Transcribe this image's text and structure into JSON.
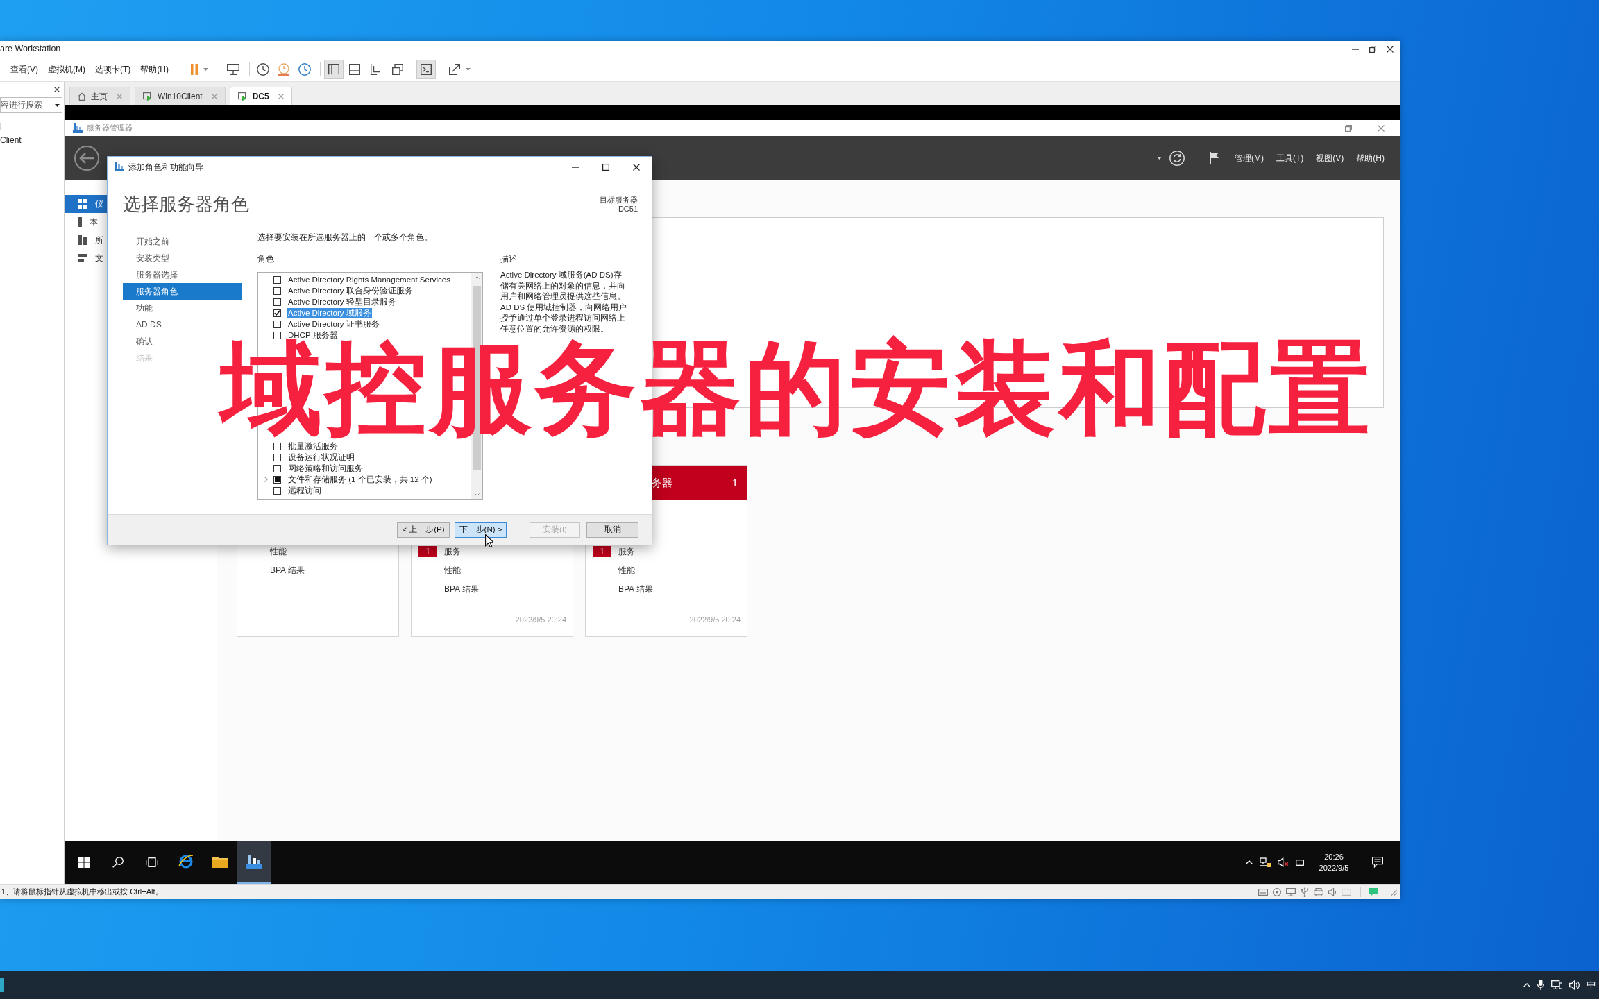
{
  "vmware": {
    "title": "are Workstation",
    "menu": [
      "查看(V)",
      "虚拟机(M)",
      "选项卡(T)",
      "帮助(H)"
    ],
    "toolbar": [
      {
        "pressed": false
      },
      {
        "pressed": false
      },
      {
        "pressed": false
      },
      {
        "pressed": false
      },
      {
        "pressed": false
      },
      {
        "pressed": true
      },
      {
        "pressed": false
      },
      {
        "pressed": false
      },
      {
        "pressed": false
      },
      {
        "pressed": true
      },
      {
        "pressed": false
      }
    ],
    "library": {
      "search": {
        "placeholder": "容进行搜索"
      },
      "items": [
        "l",
        "Client"
      ]
    },
    "tabs": [
      {
        "label": "主页",
        "kind": "home",
        "selected": false
      },
      {
        "label": "Win10Client",
        "kind": "vm",
        "selected": false
      },
      {
        "label": "DC5",
        "kind": "vm",
        "selected": true
      }
    ],
    "status_bar": "1、请将鼠标指针从虚拟机中移出或按 Ctrl+Alt。"
  },
  "server_manager": {
    "title": "服务器管理器",
    "menu": [
      "管理(M)",
      "工具(T)",
      "视图(V)",
      "帮助(H)"
    ],
    "nav": [
      {
        "label": "仪",
        "selected": true
      },
      {
        "label": "本",
        "selected": false
      },
      {
        "label": "所",
        "selected": false
      },
      {
        "label": "文",
        "selected": false
      }
    ],
    "tiles": [
      {
        "rows": [
          {
            "label": "性能"
          },
          {
            "label": "BPA 结果"
          }
        ]
      },
      {
        "rows": [
          {
            "label": "服务",
            "badge": "1"
          },
          {
            "label": "性能"
          },
          {
            "label": "BPA 结果"
          }
        ],
        "timestamp": "2022/9/5 20:24"
      },
      {
        "header": {
          "title": "务器",
          "count": "1",
          "alert": true
        },
        "rows": [
          {
            "label": "服务",
            "badge": "1"
          },
          {
            "label": "性能"
          },
          {
            "label": "BPA 结果"
          }
        ],
        "timestamp": "2022/9/5 20:24"
      }
    ]
  },
  "wizard": {
    "title": "添加角色和功能向导",
    "heading": "选择服务器角色",
    "target_label": "目标服务器",
    "target": "DC51",
    "steps": [
      {
        "label": "开始之前",
        "selected": false,
        "disabled": false
      },
      {
        "label": "安装类型",
        "selected": false,
        "disabled": false
      },
      {
        "label": "服务器选择",
        "selected": false,
        "disabled": false
      },
      {
        "label": "服务器角色",
        "selected": true,
        "disabled": false
      },
      {
        "label": "功能",
        "selected": false,
        "disabled": false
      },
      {
        "label": "AD DS",
        "selected": false,
        "disabled": false
      },
      {
        "label": "确认",
        "selected": false,
        "disabled": false
      },
      {
        "label": "结果",
        "selected": false,
        "disabled": true
      }
    ],
    "instruction": "选择要安装在所选服务器上的一个或多个角色。",
    "roles_label": "角色",
    "roles": [
      {
        "label": "Active Directory Rights Management Services",
        "checked": false,
        "selected": false
      },
      {
        "label": "Active Directory 联合身份验证服务",
        "checked": false,
        "selected": false
      },
      {
        "label": "Active Directory 轻型目录服务",
        "checked": false,
        "selected": false
      },
      {
        "label": "Active Directory 域服务",
        "checked": true,
        "selected": true
      },
      {
        "label": "Active Directory 证书服务",
        "checked": false,
        "selected": false
      },
      {
        "label": "DHCP 服务器",
        "checked": false,
        "selected": false
      },
      {
        "selected": false
      },
      {
        "selected": false
      },
      {
        "selected": false
      },
      {
        "selected": false
      },
      {
        "selected": false
      },
      {
        "selected": false
      },
      {
        "selected": false
      },
      {
        "selected": false
      },
      {
        "selected": false
      },
      {
        "label": "批量激活服务",
        "checked": false,
        "selected": false
      },
      {
        "label": "设备运行状况证明",
        "checked": false,
        "selected": false
      },
      {
        "label": "网络策略和访问服务",
        "checked": false,
        "selected": false
      },
      {
        "label": "文件和存储服务 (1 个已安装，共 12 个)",
        "checked": false,
        "partial": true,
        "selected": false,
        "expanded": false
      },
      {
        "label": "远程访问",
        "checked": false,
        "selected": false
      }
    ],
    "description_label": "描述",
    "description": "Active Directory 域服务(AD DS)存储有关网络上的对象的信息，并向用户和网络管理员提供这些信息。AD DS 使用域控制器，向网络用户授予通过单个登录进程访问网络上任意位置的允许资源的权限。",
    "buttons": [
      {
        "label": "< 上一步(P)",
        "focused": false,
        "disabled": false
      },
      {
        "label": "下一步(N) >",
        "focused": true,
        "disabled": false
      },
      {
        "label": "安装(I)",
        "focused": false,
        "disabled": true
      },
      {
        "label": "取消",
        "focused": false,
        "disabled": false
      }
    ]
  },
  "overlay_title": "域控服务器的安装和配置",
  "vm_taskbar": {
    "apps": [
      {
        "active": false
      },
      {
        "active": false
      },
      {
        "active": true
      }
    ],
    "time": "20:26",
    "date": "2022/9/5"
  },
  "host_taskbar": {
    "ime": "中"
  }
}
